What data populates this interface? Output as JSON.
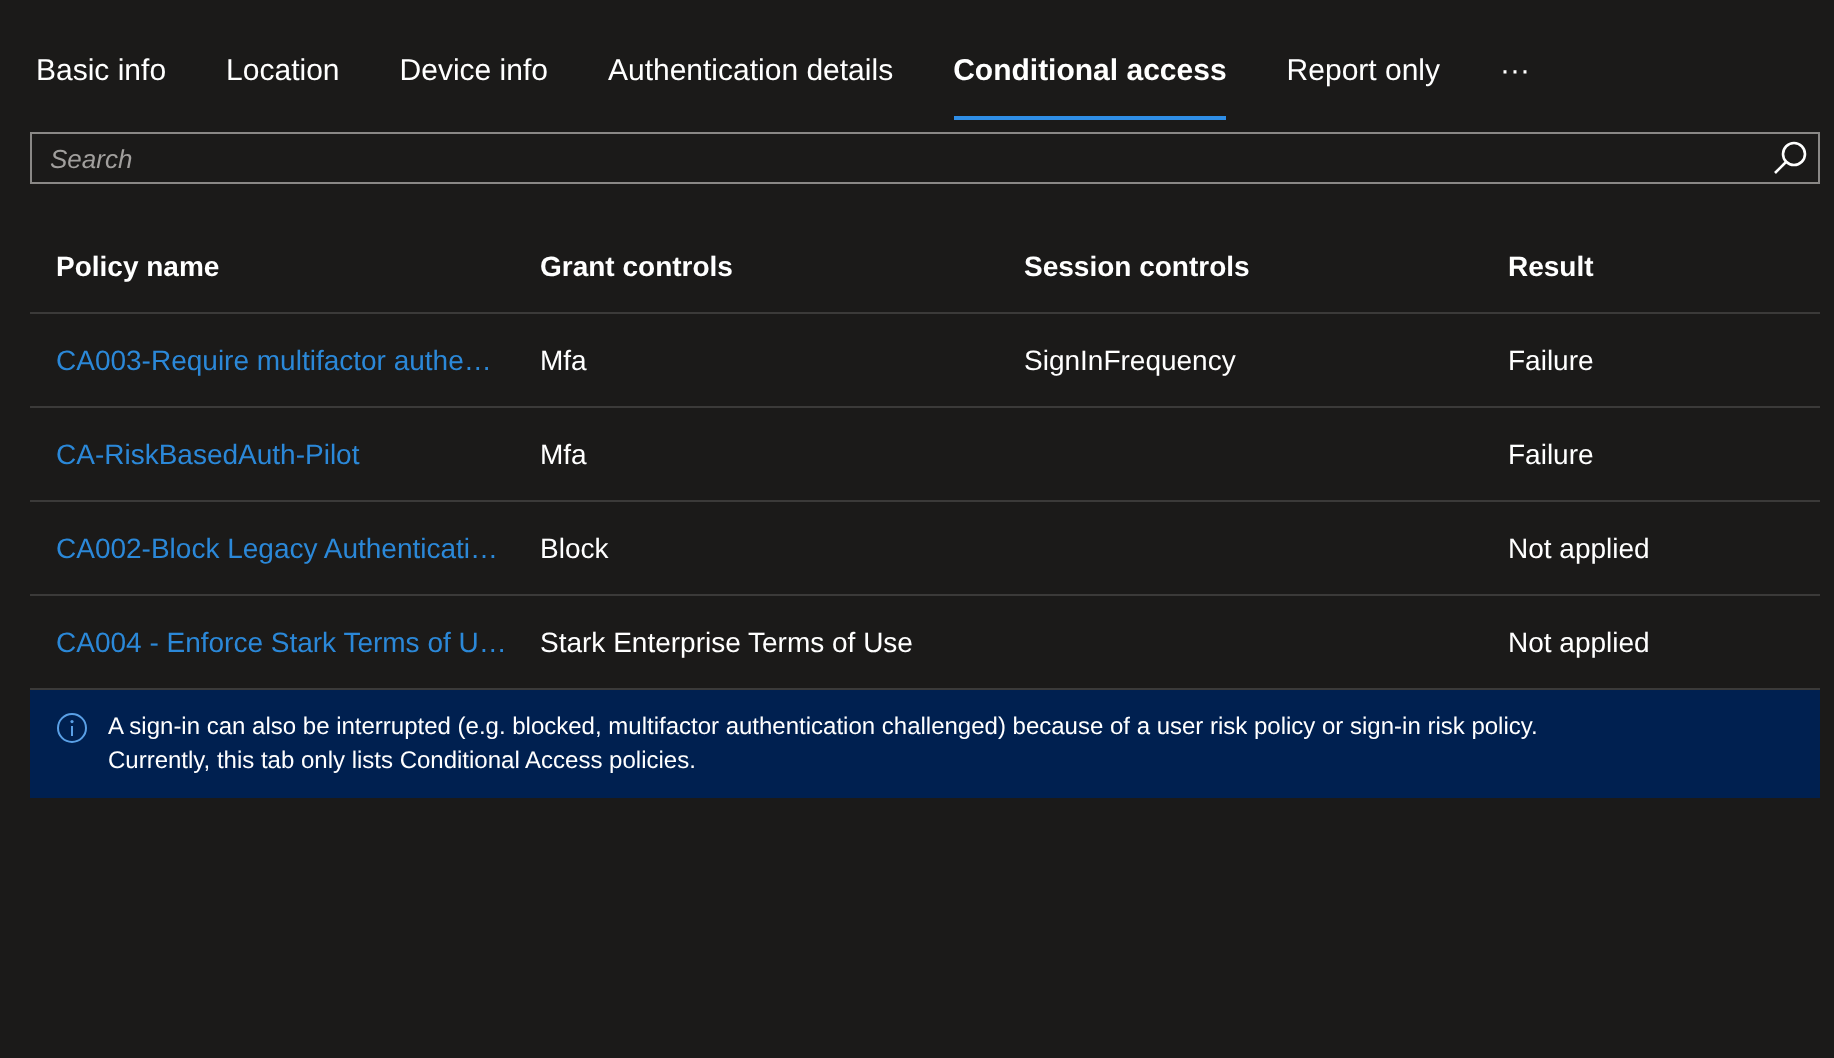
{
  "tabs": [
    {
      "label": "Basic info",
      "selected": false
    },
    {
      "label": "Location",
      "selected": false
    },
    {
      "label": "Device info",
      "selected": false
    },
    {
      "label": "Authentication details",
      "selected": false
    },
    {
      "label": "Conditional access",
      "selected": true
    },
    {
      "label": "Report only",
      "selected": false
    },
    {
      "label": "···",
      "selected": false
    }
  ],
  "search": {
    "placeholder": "Search"
  },
  "table": {
    "columns": [
      "Policy name",
      "Grant controls",
      "Session controls",
      "Result"
    ],
    "rows": [
      [
        "CA003-Require multifactor authe…",
        "Mfa",
        "SignInFrequency",
        "Failure"
      ],
      [
        "CA-RiskBasedAuth-Pilot",
        "Mfa",
        "",
        "Failure"
      ],
      [
        "CA002-Block Legacy Authenticati…",
        "Block",
        "",
        "Not applied"
      ],
      [
        "CA004 - Enforce Stark Terms of U…",
        "Stark Enterprise Terms of Use",
        "",
        "Not applied"
      ]
    ]
  },
  "info_banner": {
    "lines": [
      "A sign-in can also be interrupted (e.g. blocked, multifactor authentication challenged) because of a user risk policy or sign-in risk policy.",
      "Currently, this tab only lists Conditional Access policies."
    ]
  }
}
